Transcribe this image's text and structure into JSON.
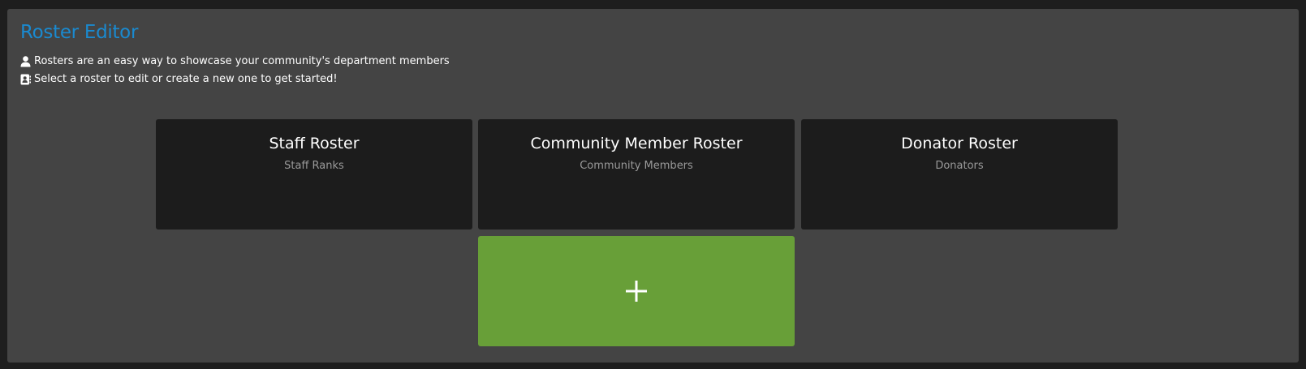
{
  "header": {
    "title": "Roster Editor",
    "line1_icon": "user-icon",
    "line1_text": "Rosters are an easy way to showcase your community's department members",
    "line2_icon": "address-book-icon",
    "line2_text": "Select a roster to edit or create a new one to get started!"
  },
  "rosters": [
    {
      "title": "Staff Roster",
      "subtitle": "Staff Ranks"
    },
    {
      "title": "Community Member Roster",
      "subtitle": "Community Members"
    },
    {
      "title": "Donator Roster",
      "subtitle": "Donators"
    }
  ],
  "add_roster": {
    "icon": "plus-icon"
  },
  "colors": {
    "background": "#1e1e1e",
    "panel": "#444444",
    "title": "#1a8ad0",
    "card": "#1c1c1c",
    "add_card": "#689f38",
    "subtitle": "#9a9a9a"
  }
}
